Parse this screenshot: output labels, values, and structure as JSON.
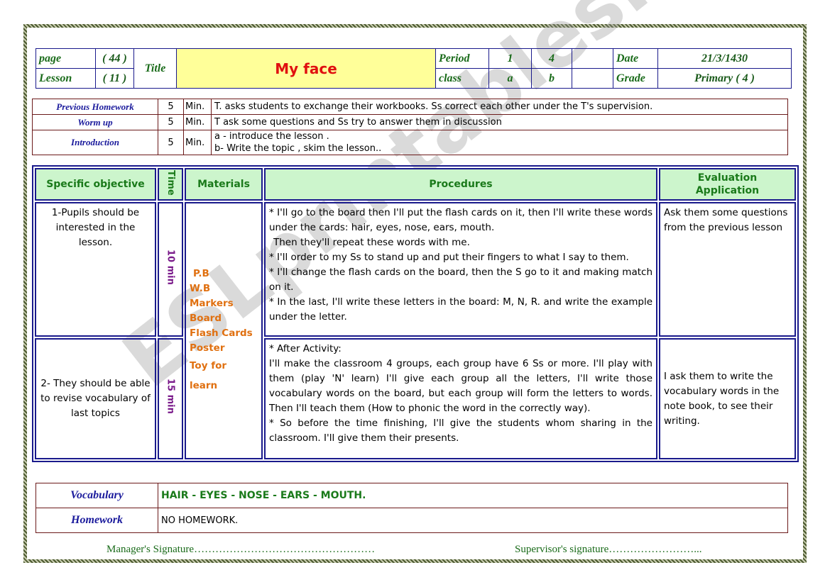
{
  "header": {
    "page_label": "page",
    "page_value": "( 44 )",
    "lesson_label": "Lesson",
    "lesson_value": "( 11 )",
    "title_label": "Title",
    "title": "My face",
    "period_label": "Period",
    "period_1": "1",
    "period_2": "4",
    "class_label": "class",
    "class_1": "a",
    "class_2": "b",
    "date_label": "Date",
    "date_value": "21/3/1430",
    "grade_label": "Grade",
    "grade_value": "Primary ( 4 )"
  },
  "warmup": [
    {
      "label": "Previous Homework",
      "time": "5",
      "unit": "Min.",
      "text": "T. asks students to exchange their workbooks. Ss correct each other under the T's supervision."
    },
    {
      "label": "Worm up",
      "time": "5",
      "unit": "Min.",
      "text": "T ask some questions and Ss try to answer them in discussion"
    },
    {
      "label": "Introduction",
      "time": "5",
      "unit": "Min.",
      "text_a": "a - introduce the lesson .",
      "text_b": "b- Write the topic , skim the lesson.."
    }
  ],
  "main": {
    "headers": {
      "objective": "Specific objective",
      "time": "Time",
      "materials": "Materials",
      "procedures": "Procedures",
      "evaluation_1": "Evaluation",
      "evaluation_2": "Application"
    },
    "materials": [
      "P.B",
      "W.B",
      "Markers",
      "Board",
      "Flash Cards",
      "Poster",
      "Toy for learn"
    ],
    "rows": [
      {
        "objective": "1-Pupils should be interested in the lesson.",
        "time": "10 min",
        "procedures": [
          "* I'll go to the board then I'll put the flash cards on it, then I'll write these words under the cards: hair, eyes, nose, ears, mouth.",
          "Then they'll repeat these words with me.",
          "* I'll order to my Ss to stand up and put their fingers to what I say to them.",
          "* I'll change the flash cards on the board, then the S go to it and making match on it.",
          "* In the last, I'll write these letters in the board: M, N, R. and write the example under the letter."
        ],
        "evaluation": "Ask them some questions from the previous lesson"
      },
      {
        "objective": "2- They should be able to revise vocabulary of last topics",
        "time": "15 min",
        "procedures": [
          "* After Activity:",
          "I'll make the classroom 4 groups, each group have 6 Ss or more. I'll play with them (play 'N' learn) I'll give each group all the letters, I'll write those vocabulary words on the board, but each group will form the letters to words. Then I'll teach them (How to phonic the word in the correctly way).",
          "* So before the time finishing, I'll give the students whom sharing in the classroom. I'll give them their presents."
        ],
        "evaluation": "I ask them to write the vocabulary words in the note book, to see their writing."
      }
    ]
  },
  "footer": {
    "vocab_label": "Vocabulary",
    "vocab_value": "HAIR - EYES - NOSE - EARS - MOUTH.",
    "homework_label": "Homework",
    "homework_value": "NO HOMEWORK.",
    "manager_sig": "Manager's Signature……………………………………………",
    "supervisor_sig": "Supervisor's signature……………………..."
  },
  "watermark": "ESLprintables.com"
}
